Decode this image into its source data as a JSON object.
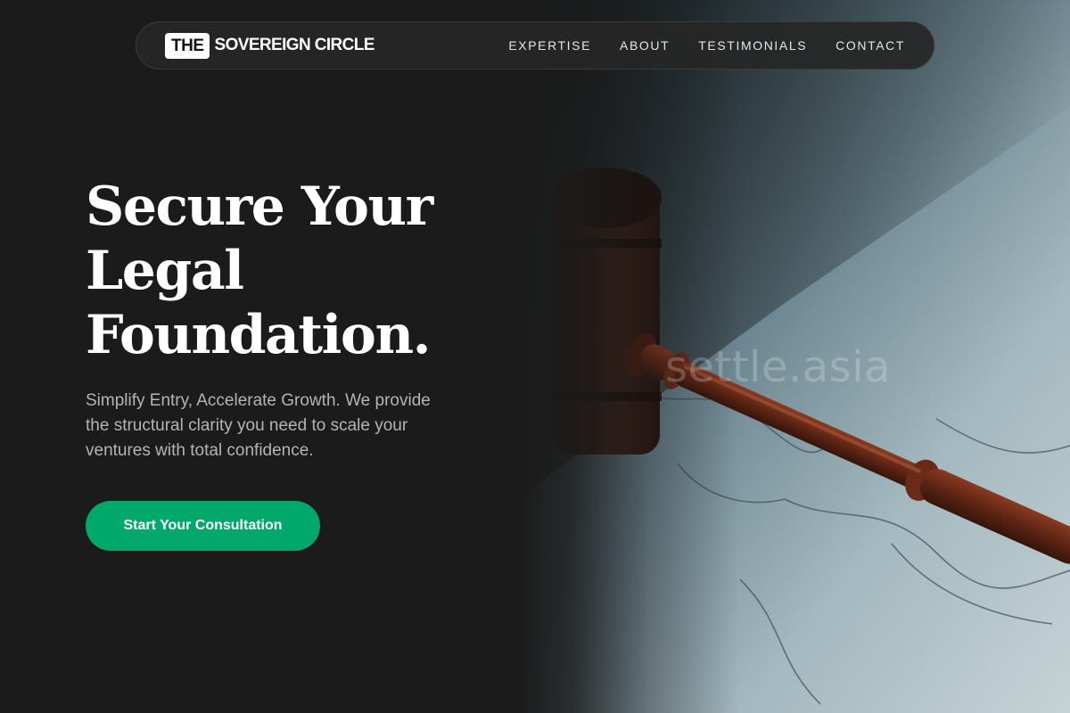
{
  "nav": {
    "logo_badge": "THE",
    "logo_text": "SOVEREIGN CIRCLE",
    "links": [
      "EXPERTISE",
      "ABOUT",
      "TESTIMONIALS",
      "CONTACT"
    ]
  },
  "hero": {
    "title_lines": [
      "Secure Your",
      "Legal",
      "Foundation."
    ],
    "subtitle": "Simplify Entry, Accelerate Growth. We provide the structural clarity you need to scale your ventures with total confidence.",
    "cta_label": "Start Your Consultation",
    "watermark": "settle.asia"
  },
  "colors": {
    "background": "#1b1b1b",
    "accent": "#00a86b",
    "text": "#ffffff",
    "muted": "#b4b4b4"
  }
}
